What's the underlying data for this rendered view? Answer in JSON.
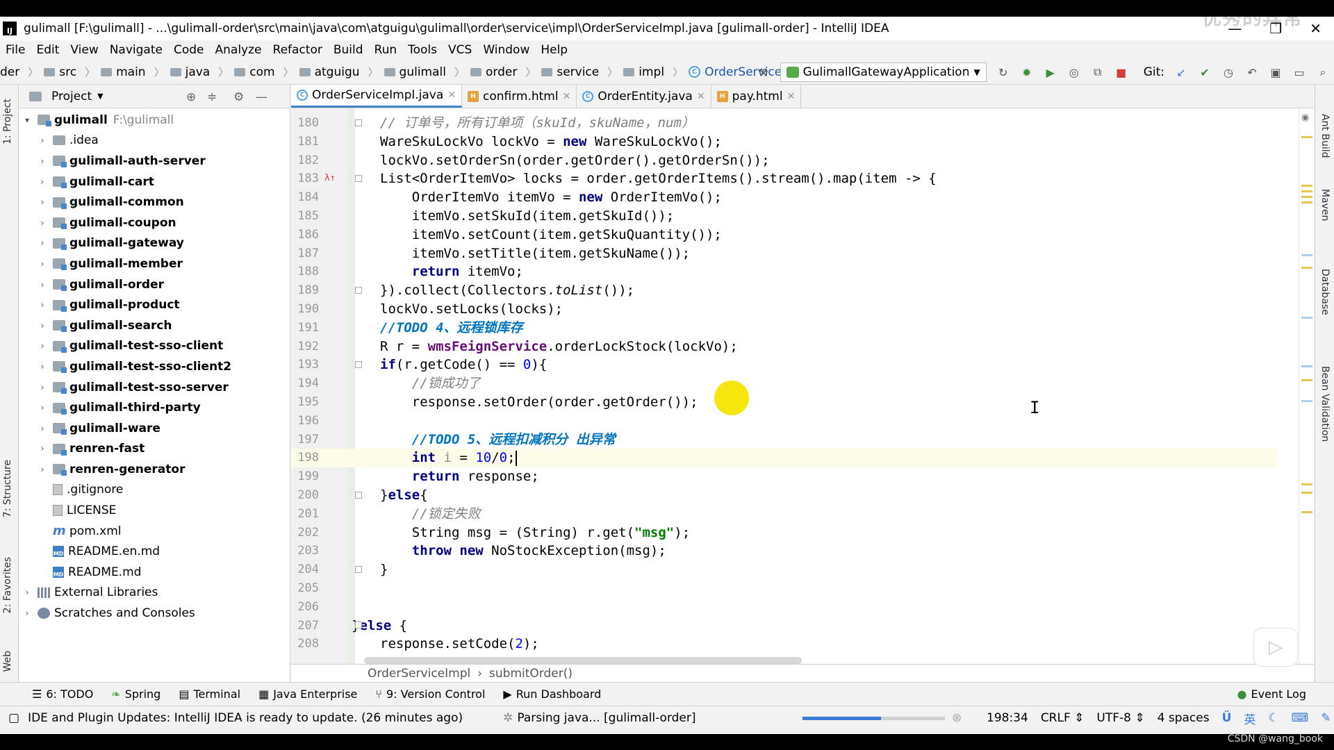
{
  "window": {
    "title": "gulimall [F:\\gulimall] - ...\\gulimall-order\\src\\main\\java\\com\\atguigu\\gulimall\\order\\service\\impl\\OrderServiceImpl.java [gulimall-order] - IntelliJ IDEA",
    "watermark": "优秀的异常",
    "minimize": "—",
    "restore": "❐",
    "close": "✕"
  },
  "menu": [
    "File",
    "Edit",
    "View",
    "Navigate",
    "Code",
    "Analyze",
    "Refactor",
    "Build",
    "Run",
    "Tools",
    "VCS",
    "Window",
    "Help"
  ],
  "nav": {
    "crumbs": [
      "der",
      "src",
      "main",
      "java",
      "com",
      "atguigu",
      "gulimall",
      "order",
      "service",
      "impl"
    ],
    "current_class": "OrderServiceImpl",
    "run_config": "GulimallGatewayApplication",
    "git_label": "Git:"
  },
  "left_strip": [
    "1: Project",
    "7: Structure",
    "2: Favorites",
    "Web"
  ],
  "right_strip": [
    "Ant Build",
    "Maven",
    "Database",
    "Bean Validation"
  ],
  "project": {
    "header": "Project",
    "root_name": "gulimall",
    "root_path": "F:\\gulimall",
    "items": [
      {
        "label": ".idea",
        "kind": "folder",
        "bold": false
      },
      {
        "label": "gulimall-auth-server",
        "kind": "module",
        "bold": true
      },
      {
        "label": "gulimall-cart",
        "kind": "module",
        "bold": true
      },
      {
        "label": "gulimall-common",
        "kind": "module",
        "bold": true
      },
      {
        "label": "gulimall-coupon",
        "kind": "module",
        "bold": true
      },
      {
        "label": "gulimall-gateway",
        "kind": "module",
        "bold": true
      },
      {
        "label": "gulimall-member",
        "kind": "module",
        "bold": true
      },
      {
        "label": "gulimall-order",
        "kind": "module",
        "bold": true
      },
      {
        "label": "gulimall-product",
        "kind": "module",
        "bold": true
      },
      {
        "label": "gulimall-search",
        "kind": "module",
        "bold": true
      },
      {
        "label": "gulimall-test-sso-client",
        "kind": "module",
        "bold": true
      },
      {
        "label": "gulimall-test-sso-client2",
        "kind": "module",
        "bold": true
      },
      {
        "label": "gulimall-test-sso-server",
        "kind": "module",
        "bold": true
      },
      {
        "label": "gulimall-third-party",
        "kind": "module",
        "bold": true
      },
      {
        "label": "gulimall-ware",
        "kind": "module",
        "bold": true
      },
      {
        "label": "renren-fast",
        "kind": "module",
        "bold": true
      },
      {
        "label": "renren-generator",
        "kind": "module",
        "bold": true
      },
      {
        "label": ".gitignore",
        "kind": "file",
        "bold": false
      },
      {
        "label": "LICENSE",
        "kind": "file",
        "bold": false
      },
      {
        "label": "pom.xml",
        "kind": "maven",
        "bold": false
      },
      {
        "label": "README.en.md",
        "kind": "md",
        "bold": false
      },
      {
        "label": "README.md",
        "kind": "md",
        "bold": false
      }
    ],
    "external_libraries": "External Libraries",
    "scratches": "Scratches and Consoles"
  },
  "tabs": [
    {
      "label": "OrderServiceImpl.java",
      "icon": "C",
      "active": true
    },
    {
      "label": "confirm.html",
      "icon": "H",
      "active": false
    },
    {
      "label": "OrderEntity.java",
      "icon": "C",
      "active": false
    },
    {
      "label": "pay.html",
      "icon": "H",
      "active": false
    }
  ],
  "code": {
    "line_numbers": [
      "180",
      "181",
      "182",
      "183",
      "184",
      "185",
      "186",
      "187",
      "188",
      "189",
      "190",
      "191",
      "192",
      "193",
      "194",
      "195",
      "196",
      "197",
      "198",
      "199",
      "200",
      "201",
      "202",
      "203",
      "204",
      "205",
      "206",
      "207",
      "208"
    ],
    "current_line": "198"
  },
  "editor_crumb": {
    "cls": "OrderServiceImpl",
    "method": "submitOrder()"
  },
  "bottom_tools": [
    "6: TODO",
    "Spring",
    "Terminal",
    "Java Enterprise",
    "9: Version Control",
    "Run Dashboard",
    "Event Log"
  ],
  "status": {
    "message": "IDE and Plugin Updates: IntelliJ IDEA is ready to update. (26 minutes ago)",
    "task": "Parsing java... [gulimall-order]",
    "progress": 0.55,
    "position": "198:34",
    "line_sep": "CRLF",
    "encoding": "UTF-8",
    "indent": "4 spaces",
    "ime": "英",
    "bottom_watermark": "CSDN @wang_book"
  },
  "colors": {
    "accent": "#4083c9",
    "keyword": "#000080",
    "todo": "#0073bf",
    "string": "#008000",
    "number": "#0000ff"
  }
}
